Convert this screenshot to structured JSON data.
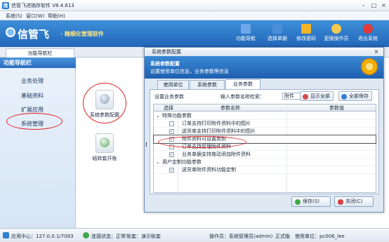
{
  "window": {
    "title": "信管飞进销存软件 V8.4.613"
  },
  "menu": [
    "系统(S)",
    "窗口(W)",
    "帮助(H)"
  ],
  "banner": {
    "brand": "信管飞",
    "slogan": "精细化管理软件"
  },
  "toolbar": [
    {
      "label": "功能导航",
      "icon": "nav-icon",
      "color": "#6fa8e8"
    },
    {
      "label": "选择单据",
      "icon": "docs-icon",
      "color": "#4a8fd8"
    },
    {
      "label": "修改密码",
      "icon": "lock-icon",
      "color": "#f2b324"
    },
    {
      "label": "更换操作员",
      "icon": "user-icon",
      "color": "#f2c94c"
    },
    {
      "label": "退出系统",
      "icon": "exit-icon",
      "color": "#e03a3a"
    }
  ],
  "nav_tab": "功能导航栏",
  "sidebar": {
    "heading": "功能导航栏",
    "items": [
      "业务处理",
      "基础资料",
      "扩展应用",
      "系统管理"
    ]
  },
  "main_tiles": [
    {
      "label": "系统参数配置",
      "icon": "database-settings-icon"
    },
    {
      "label": "结转套开账",
      "icon": "database-add-icon"
    }
  ],
  "dialog": {
    "title": "系统参数配置",
    "header_title": "系统参数配置",
    "header_desc": "设置使用单位信息，业务参数等信息",
    "tabs": [
      "使用单位",
      "系统参数",
      "业务参数"
    ],
    "active_tab": 2,
    "section_label": "设置业务参数",
    "search_label": "输入参数名称检索：",
    "search_value": "附件",
    "show_all": "显示全部",
    "save_all": "全部保存",
    "columns": [
      "选择",
      "参数名称",
      "参数值"
    ],
    "rows": [
      {
        "type": "group",
        "name": "特殊功能参数"
      },
      {
        "type": "item",
        "checked": false,
        "name": "订单支持打印附件资料中的图片"
      },
      {
        "type": "item",
        "checked": true,
        "name": "送货单支持打印附件资料中的图片"
      },
      {
        "type": "item",
        "checked": true,
        "name": "附件资料可设置类别",
        "selected": true
      },
      {
        "type": "item",
        "checked": false,
        "name": "订单支持管理附件资料"
      },
      {
        "type": "item",
        "checked": true,
        "name": "业务单据支持拖动添加附件资料"
      },
      {
        "type": "group",
        "name": "用户定制功能参数"
      },
      {
        "type": "item",
        "checked": true,
        "name": "送货单附件资料功能定制"
      }
    ],
    "save_button": "保存(S)",
    "close_button": "关闭(C)"
  },
  "status": {
    "app_center": "应用中心：127.0.0.1/7093",
    "connection": "连接状态：正常",
    "account": "账套：演示账套",
    "operator": "操作员：系统管理员(admin)",
    "edition": "正式版",
    "unit": "使用单位：pc006_lee"
  }
}
